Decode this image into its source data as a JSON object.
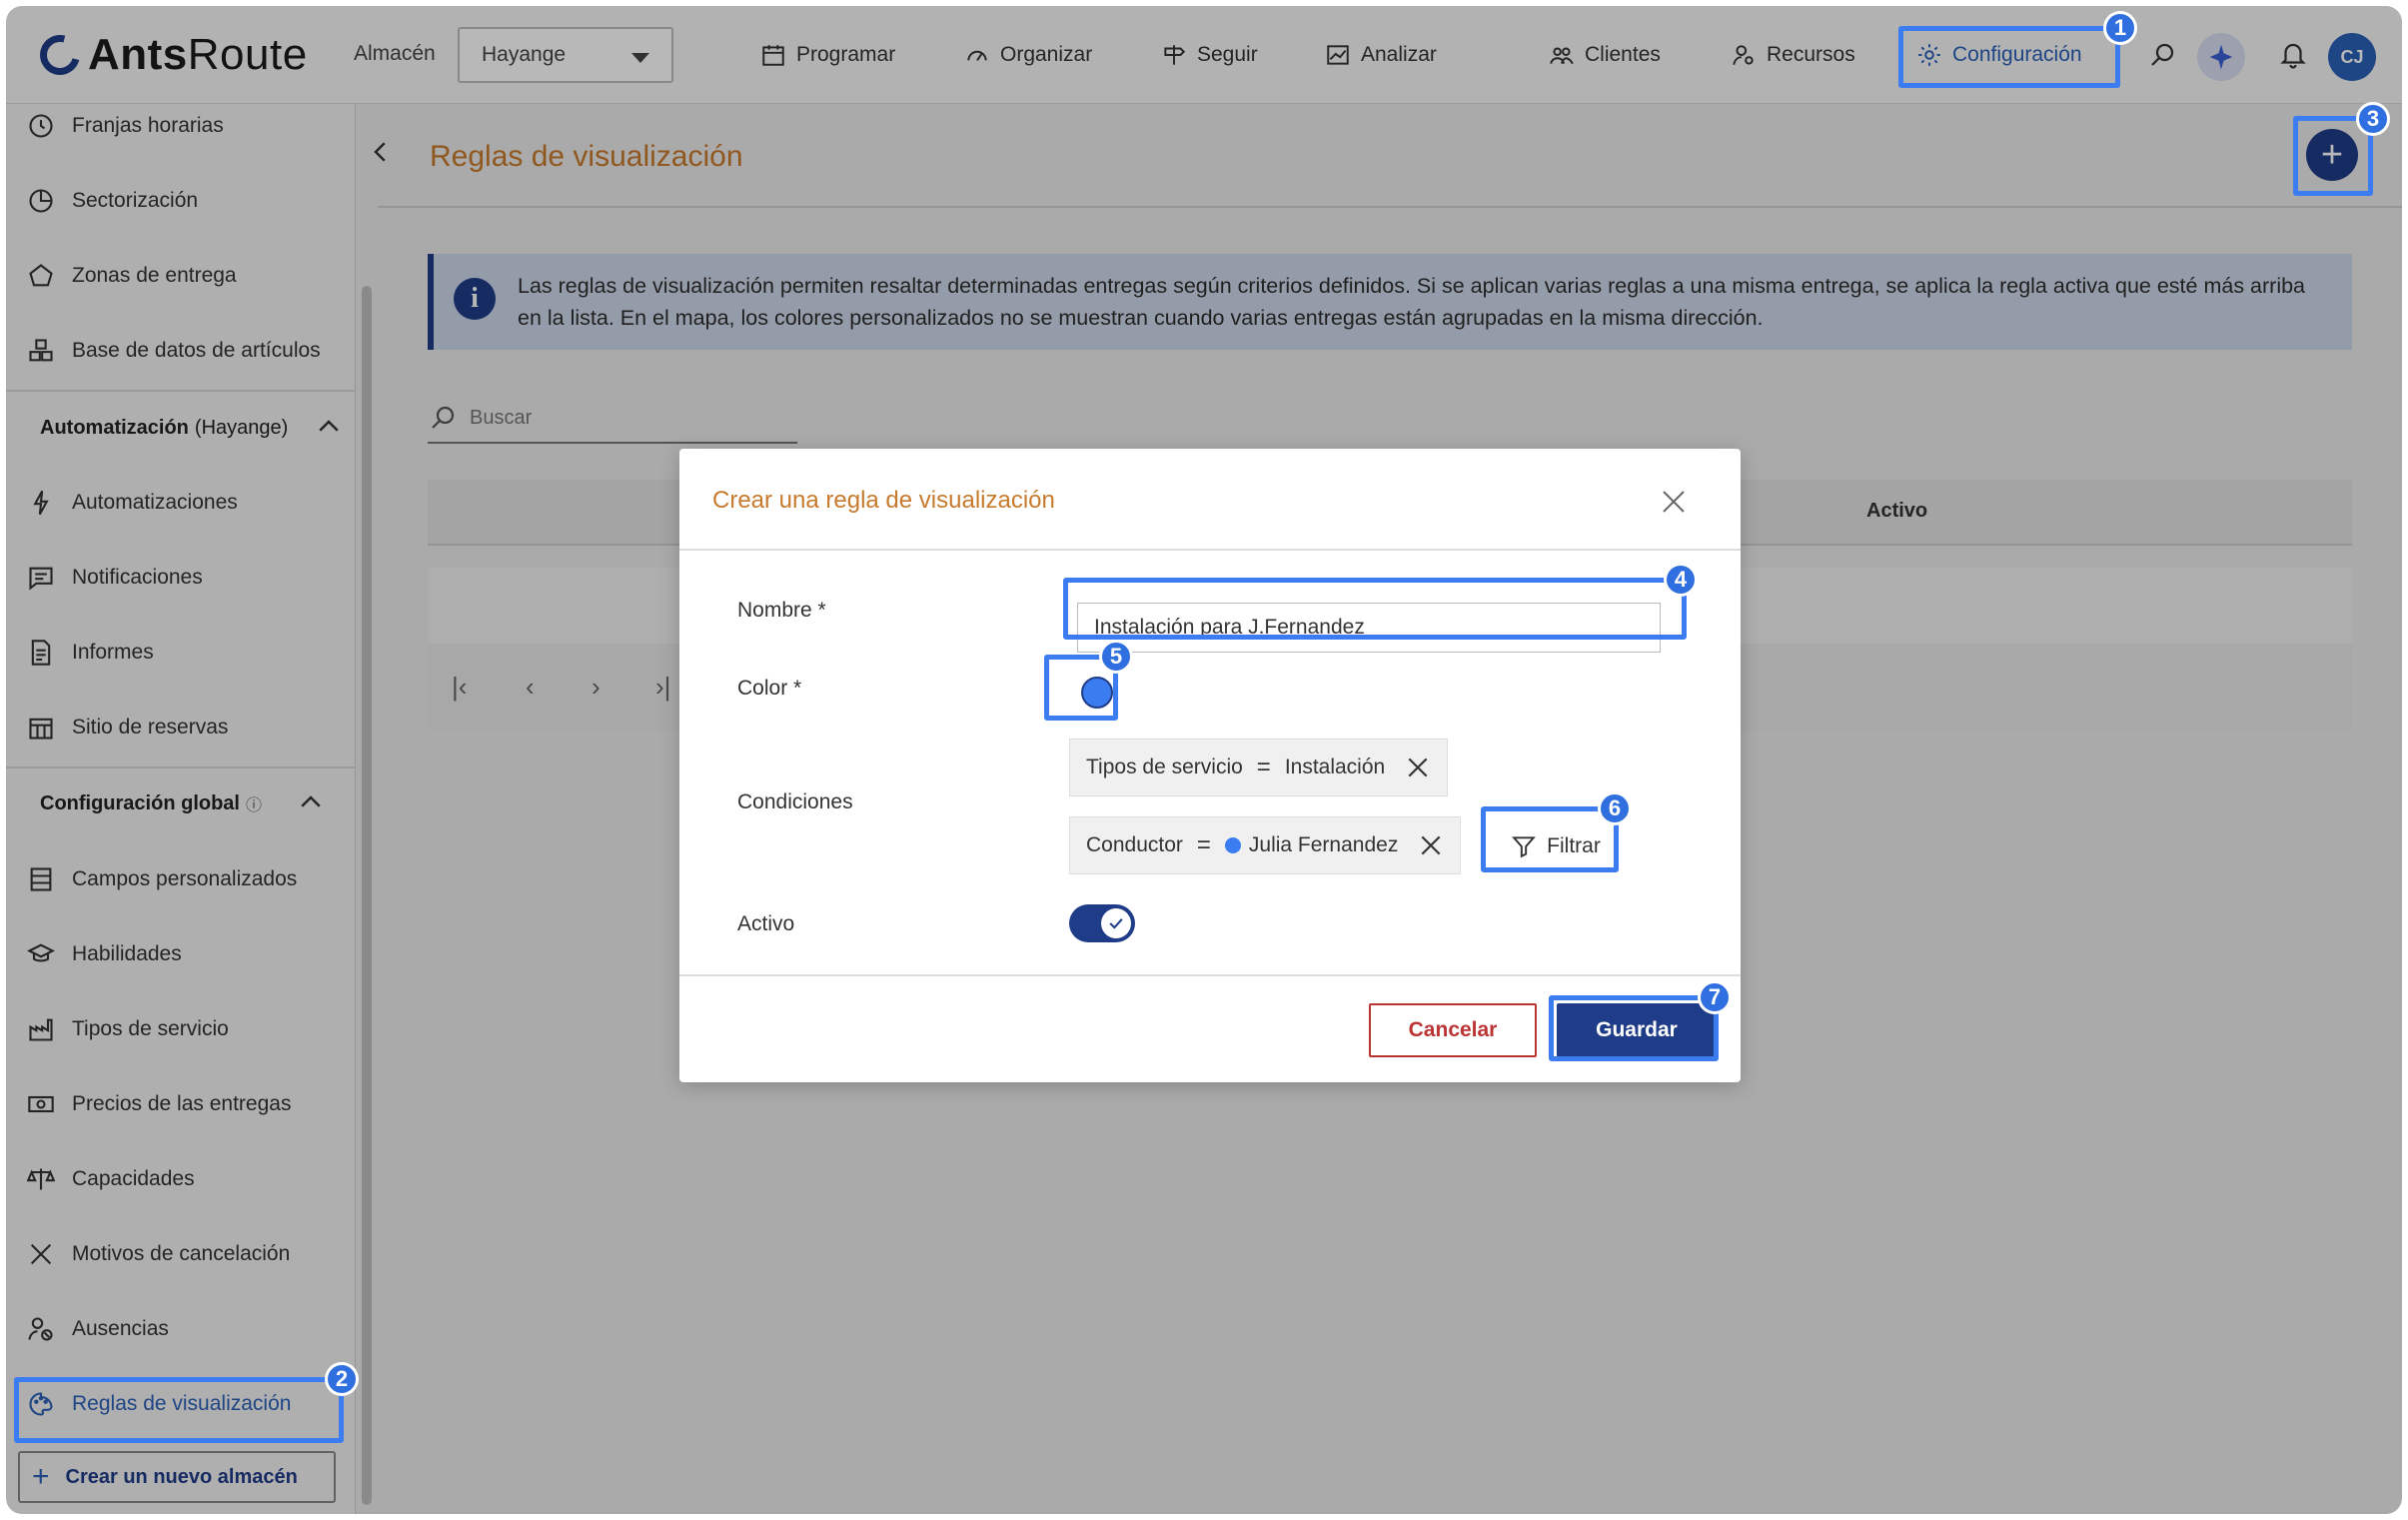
{
  "app": {
    "logo_bold": "Ants",
    "logo_rest": "Route"
  },
  "header": {
    "warehouse_label": "Almacén",
    "warehouse_value": "Hayange",
    "nav": [
      {
        "label": "Programar",
        "icon": "calendar-icon"
      },
      {
        "label": "Organizar",
        "icon": "gauge-icon"
      },
      {
        "label": "Seguir",
        "icon": "signpost-icon"
      },
      {
        "label": "Analizar",
        "icon": "chart-icon"
      },
      {
        "label": "Clientes",
        "icon": "users-icon"
      },
      {
        "label": "Recursos",
        "icon": "user-gear-icon"
      },
      {
        "label": "Configuración",
        "icon": "gear-icon"
      }
    ],
    "avatar_initials": "CJ"
  },
  "sidebar": {
    "items_top": [
      {
        "label": "Franjas horarias",
        "icon": "clock-icon"
      },
      {
        "label": "Sectorización",
        "icon": "pie-icon"
      },
      {
        "label": "Zonas de entrega",
        "icon": "pentagon-icon"
      },
      {
        "label": "Base de datos de artículos",
        "icon": "boxes-icon"
      }
    ],
    "section_automation": {
      "title": "Automatización",
      "sub": "(Hayange)"
    },
    "items_automation": [
      {
        "label": "Automatizaciones",
        "icon": "bolt-icon"
      },
      {
        "label": "Notificaciones",
        "icon": "message-icon"
      },
      {
        "label": "Informes",
        "icon": "document-icon"
      },
      {
        "label": "Sitio de reservas",
        "icon": "calendar-grid-icon"
      }
    ],
    "section_global": {
      "title": "Configuración global",
      "info": "ⓘ"
    },
    "items_global": [
      {
        "label": "Campos personalizados",
        "icon": "form-icon"
      },
      {
        "label": "Habilidades",
        "icon": "graduation-icon"
      },
      {
        "label": "Tipos de servicio",
        "icon": "factory-icon"
      },
      {
        "label": "Precios de las entregas",
        "icon": "money-icon"
      },
      {
        "label": "Capacidades",
        "icon": "scale-icon"
      },
      {
        "label": "Motivos de cancelación",
        "icon": "x-icon"
      },
      {
        "label": "Ausencias",
        "icon": "user-off-icon"
      },
      {
        "label": "Reglas de visualización",
        "icon": "palette-icon"
      }
    ],
    "new_warehouse": "Crear un nuevo almacén"
  },
  "main": {
    "title": "Reglas de visualización",
    "info": "Las reglas de visualización permiten resaltar determinadas entregas según criterios definidos. Si se aplican varias reglas a una misma entrega, se aplica la regla activa que esté más arriba en la lista. En el mapa, los colores personalizados no se muestran cuando varias entregas están agrupadas en la misma dirección.",
    "search_placeholder": "Buscar",
    "column_active": "Activo",
    "pager": {
      "first": "|‹",
      "prev": "‹",
      "next": "›",
      "last": "›|"
    }
  },
  "modal": {
    "title": "Crear una regla de visualización",
    "name_label": "Nombre *",
    "name_value": "Instalación para J.Fernandez",
    "color_label": "Color *",
    "color_value": "#3b7df0",
    "conditions_label": "Condiciones",
    "conditions": [
      {
        "field": "Tipos de servicio",
        "op": "=",
        "value": "Instalación"
      },
      {
        "field": "Conductor",
        "op": "=",
        "value": "Julia Fernandez"
      }
    ],
    "filter_label": "Filtrar",
    "active_label": "Activo",
    "active_value": true,
    "cancel_label": "Cancelar",
    "save_label": "Guardar"
  },
  "annotations": [
    "1",
    "2",
    "3",
    "4",
    "5",
    "6",
    "7"
  ],
  "colors": {
    "brand": "#1f3c88",
    "accent": "#c87a2c",
    "highlight": "#3b7df0"
  }
}
